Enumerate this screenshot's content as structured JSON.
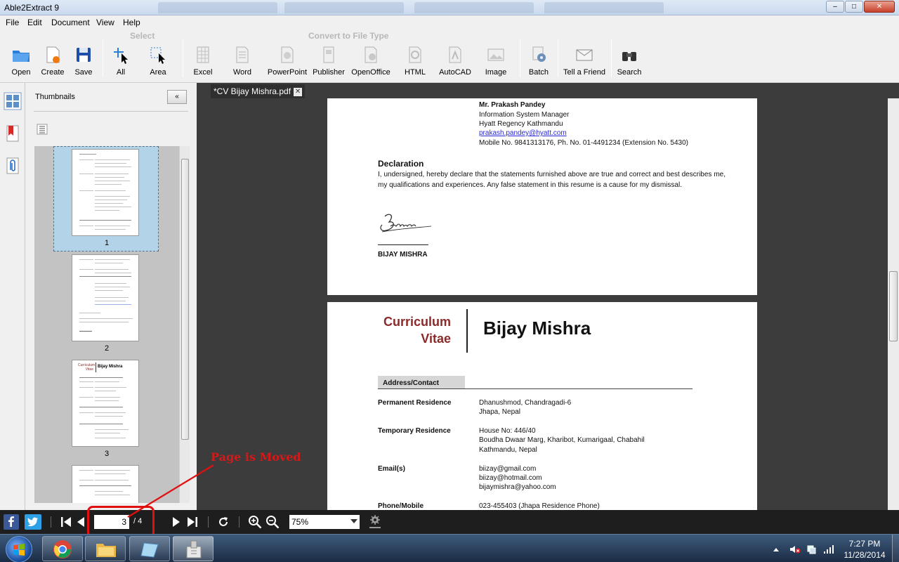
{
  "window": {
    "title": "Able2Extract 9",
    "minimize": "–",
    "maximize": "□",
    "close": "✕"
  },
  "menu": [
    "File",
    "Edit",
    "Document",
    "View",
    "Help"
  ],
  "toolbar": {
    "select_group": "Select",
    "convert_group": "Convert to File Type",
    "buttons": {
      "open": "Open",
      "create": "Create",
      "save": "Save",
      "all": "All",
      "area": "Area",
      "excel": "Excel",
      "word": "Word",
      "powerpoint": "PowerPoint",
      "publisher": "Publisher",
      "openoffice": "OpenOffice",
      "html": "HTML",
      "autocad": "AutoCAD",
      "image": "Image",
      "batch": "Batch",
      "tell_a_friend": "Tell a Friend",
      "search": "Search"
    }
  },
  "thumbnails": {
    "title": "Thumbnails",
    "collapse": "«",
    "items": [
      {
        "label": "1",
        "selected": true
      },
      {
        "label": "2",
        "selected": false
      },
      {
        "label": "3",
        "selected": false
      }
    ],
    "thumb3_curriculum": "Curriculum",
    "thumb3_vitae": "Vitae",
    "thumb3_name": "Bijay Mishra"
  },
  "document": {
    "tab_title": "*CV Bijay Mishra.pdf",
    "tab_close": "✕",
    "page_a": {
      "ref_name": "Mr. Prakash Pandey",
      "ref_title": "Information System Manager",
      "ref_org": "Hyatt Regency Kathmandu",
      "ref_email": "prakash.pandey@hyatt.com",
      "ref_phone": "Mobile No. 9841313176, Ph. No. 01-4491234 (Extension No. 5430)",
      "declaration_heading": "Declaration",
      "declaration_text": "I, undersigned, hereby declare that the statements furnished above are true and correct and best describes me, my qualifications and experiences. Any false statement in this resume is a cause for my dismissal.",
      "signature_name": "BIJAY MISHRA"
    },
    "page_b": {
      "curriculum": "Curriculum",
      "vitae": "Vitae",
      "name": "Bijay Mishra",
      "section_address": "Address/Contact",
      "permanent_label": "Permanent Residence",
      "permanent_line1": "Dhanushmod, Chandragadi-6",
      "permanent_line2": "Jhapa, Nepal",
      "temporary_label": "Temporary Residence",
      "temporary_line1": "House No: 446/40",
      "temporary_line2": "Boudha Dwaar Marg, Kharibot, Kumarigaal, Chabahil",
      "temporary_line3": "Kathmandu, Nepal",
      "email_label": "Email(s)",
      "email1": "biizay@gmail.com",
      "email2": "biizay@hotmail.com",
      "email3": "bijaymishra@yahoo.com",
      "phone_label": "Phone/Mobile",
      "phone1": "023-455403 (Jhapa Residence Phone)"
    }
  },
  "navigation": {
    "current_page": "3",
    "total_pages": "/ 4",
    "zoom": "75%"
  },
  "annotation": {
    "label": "Page is Moved",
    "color": "#d11a1a"
  },
  "taskbar": {
    "time": "7:27 PM",
    "date": "11/28/2014"
  },
  "colors": {
    "accent_maroon": "#8b2a2a",
    "doc_background": "#3c3c3c",
    "thumb_selected": "#b3d3e8"
  }
}
